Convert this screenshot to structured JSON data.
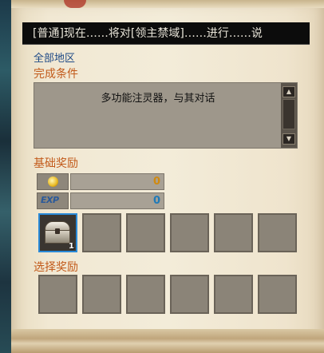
{
  "quest": {
    "title": "[普通]现在……将对[领主禁域]……进行……说",
    "region": "全部地区",
    "conditions_heading": "完成条件",
    "condition_text": "多功能注灵器，与其对话",
    "basic_rewards_heading": "基础奖励",
    "gold_value": "0",
    "exp_label": "EXP",
    "exp_value": "0",
    "reward_item_count": "1",
    "choice_rewards_heading": "选择奖励"
  },
  "colors": {
    "heading": "#c25a1a",
    "region": "#1f4a86",
    "gold_value": "#d08a10",
    "exp_value": "#1f7ab8",
    "slot_highlight": "#2a8ad8"
  },
  "icons": {
    "gold": "gold-coin-icon",
    "item": "chest-icon"
  }
}
